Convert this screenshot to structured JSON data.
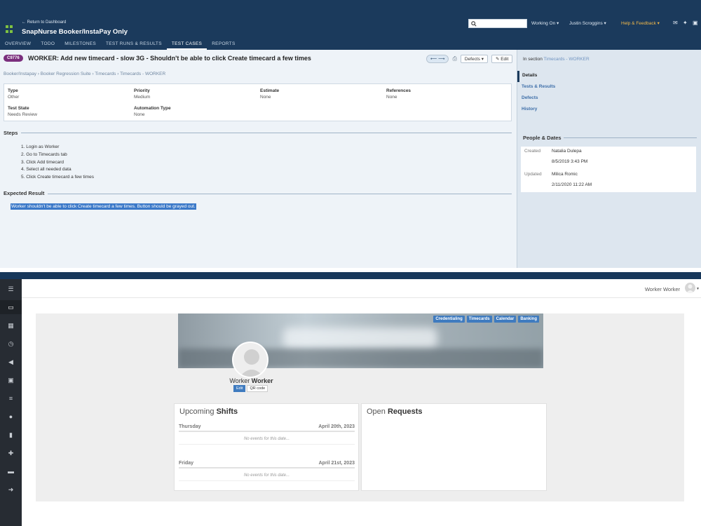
{
  "testrail": {
    "return_link": "← Return to Dashboard",
    "project_name": "SnapNurse Booker/InstaPay Only",
    "search_placeholder": "",
    "header_links": {
      "working_on": "Working On ▾",
      "user": "Justin Scroggins ▾",
      "help": "Help & Feedback ▾"
    },
    "tabs": [
      "OVERVIEW",
      "TODO",
      "MILESTONES",
      "TEST RUNS & RESULTS",
      "TEST CASES",
      "REPORTS"
    ],
    "active_tab": "TEST CASES",
    "case_id": "C9776",
    "case_title": "WORKER: Add new timecard - slow 3G - Shouldn't be able to click Create timecard a few times",
    "toolbar": {
      "defects": "Defects ▾",
      "edit": "✎ Edit",
      "nav": "⟵ ⟶"
    },
    "breadcrumb": "Booker/Instapay › Booker Regression Suite › Timecards › Timecards - WORKER",
    "fields": {
      "type": {
        "label": "Type",
        "value": "Other"
      },
      "priority": {
        "label": "Priority",
        "value": "Medium"
      },
      "estimate": {
        "label": "Estimate",
        "value": "None"
      },
      "references": {
        "label": "References",
        "value": "None"
      },
      "test_state": {
        "label": "Test State",
        "value": "Needs Review"
      },
      "automation_type": {
        "label": "Automation Type",
        "value": "None"
      }
    },
    "steps_title": "Steps",
    "steps": [
      "1. Login as Worker",
      "2. Go to Timecards tab",
      "3. Click Add timecard",
      "4. Select all needed data",
      "5. Click Create timecard a few times"
    ],
    "expected_title": "Expected Result",
    "expected_text": "Worker shouldn't be able to click Create timecard a few times. Button should be grayed out.",
    "side": {
      "in_section_prefix": "In section",
      "in_section_link": "Timecards - WORKER",
      "nav": [
        "Details",
        "Tests & Results",
        "Defects",
        "History"
      ],
      "people_dates_title": "People & Dates",
      "created_label": "Created",
      "created_by": "Natalia Dulepa",
      "created_at": "8/5/2019 3:43 PM",
      "updated_label": "Updated",
      "updated_by": "Milica Romic",
      "updated_at": "2/11/2020 11:22 AM"
    }
  },
  "worker_app": {
    "user_name": "Worker Worker",
    "cover_tabs": [
      "Credentialing",
      "Timecards",
      "Calendar",
      "Banking"
    ],
    "profile_first": "Worker",
    "profile_last": "Worker",
    "edit_label": "Edit",
    "qr_label": "QR code",
    "shifts_title_light": "Upcoming",
    "shifts_title_bold": "Shifts",
    "requests_title_light": "Open",
    "requests_title_bold": "Requests",
    "days": [
      {
        "day": "Thursday",
        "date": "April 20th, 2023",
        "empty": "No events for this date..."
      },
      {
        "day": "Friday",
        "date": "April 21st, 2023",
        "empty": "No events for this date..."
      }
    ]
  }
}
